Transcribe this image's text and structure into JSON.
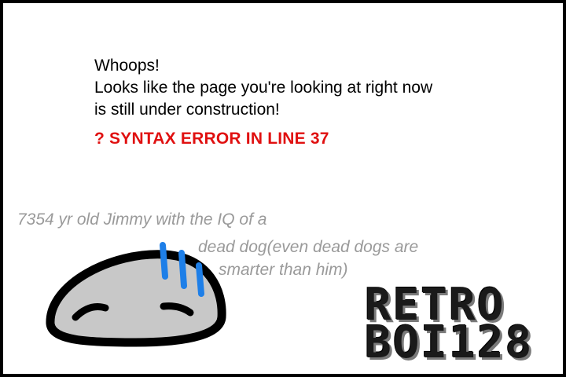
{
  "message": {
    "line1": "Whoops!",
    "line2": "Looks like the page you're looking at right now",
    "line3": "is still under construction!"
  },
  "error": {
    "text": "?  SYNTAX ERROR IN LINE 37",
    "color": "#e01010"
  },
  "caption": {
    "line1": "7354 yr old Jimmy with the IQ of a",
    "line2": "dead dog(even dead dogs are",
    "line3": "smarter than him)"
  },
  "logo": {
    "line1": "RETRO",
    "line2": "BOI128"
  },
  "icons": {
    "character": "sweating-blob-character-illustration",
    "sweat": "sweat-drops-icon"
  },
  "colors": {
    "background": "#ffffff",
    "border": "#000000",
    "caption": "#9a9a9a",
    "blob_fill": "#c8c8c8",
    "sweat": "#1e7fe8"
  }
}
